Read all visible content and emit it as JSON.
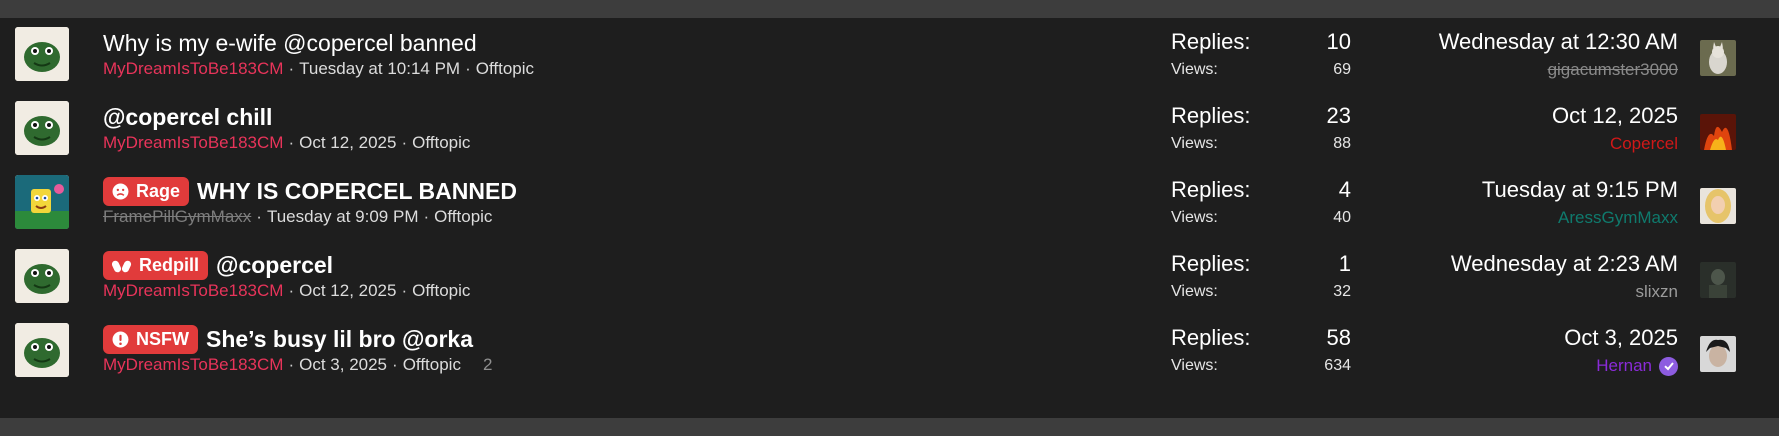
{
  "stat_labels": {
    "replies": "Replies:",
    "views": "Views:"
  },
  "colors": {
    "background": "#1e1e1e",
    "band": "#3d3d3d",
    "prefix_label": "#e13b3b",
    "author_pink": "#e8345a",
    "user_red": "#d01818",
    "user_teal": "#0f7a6d",
    "user_purple": "#8a2bd8"
  },
  "threads": [
    {
      "avatar_icon": "green-blob-avatar-icon",
      "prefix": null,
      "title": "Why is my e-wife @copercel banned",
      "title_bold": false,
      "author": "MyDreamIsToBe183CM",
      "date": "Tuesday at 10:14 PM",
      "forum": "Offtopic",
      "pages": null,
      "replies": "10",
      "views": "69",
      "last_date": "Wednesday at 12:30 AM",
      "last_user": "gigacumster3000",
      "last_user_style": "banned",
      "last_avatar_icon": "white-cat-avatar-icon",
      "verified": false
    },
    {
      "avatar_icon": "green-blob-avatar-icon",
      "prefix": null,
      "title": "@copercel chill",
      "title_bold": true,
      "author": "MyDreamIsToBe183CM",
      "date": "Oct 12, 2025",
      "forum": "Offtopic",
      "pages": null,
      "replies": "23",
      "views": "88",
      "last_date": "Oct 12, 2025",
      "last_user": "Copercel",
      "last_user_style": "red",
      "last_avatar_icon": "fire-avatar-icon",
      "verified": false
    },
    {
      "avatar_icon": "cartoon-sponge-avatar-icon",
      "prefix": {
        "text": "Rage",
        "icon": "angry-face-icon"
      },
      "title": "WHY IS COPERCEL BANNED",
      "title_bold": true,
      "author": "FramePillGymMaxx",
      "author_banned": true,
      "date": "Tuesday at 9:09 PM",
      "forum": "Offtopic",
      "pages": null,
      "replies": "4",
      "views": "40",
      "last_date": "Tuesday at 9:15 PM",
      "last_user": "AressGymMaxx",
      "last_user_style": "teal",
      "last_avatar_icon": "blonde-person-avatar-icon",
      "verified": false
    },
    {
      "avatar_icon": "green-blob-avatar-icon",
      "prefix": {
        "text": "Redpill",
        "icon": "pills-icon"
      },
      "title": "@copercel",
      "title_bold": true,
      "author": "MyDreamIsToBe183CM",
      "date": "Oct 12, 2025",
      "forum": "Offtopic",
      "pages": null,
      "replies": "1",
      "views": "32",
      "last_date": "Wednesday at 2:23 AM",
      "last_user": "slixzn",
      "last_user_style": "gray",
      "last_avatar_icon": "dark-figure-avatar-icon",
      "verified": false
    },
    {
      "avatar_icon": "green-blob-avatar-icon",
      "prefix": {
        "text": "NSFW",
        "icon": "exclamation-icon"
      },
      "title": "She’s busy lil bro @orka",
      "title_bold": true,
      "author": "MyDreamIsToBe183CM",
      "date": "Oct 3, 2025",
      "forum": "Offtopic",
      "pages": "2",
      "replies": "58",
      "views": "634",
      "last_date": "Oct 3, 2025",
      "last_user": "Hernan",
      "last_user_style": "purple",
      "last_avatar_icon": "dark-hair-face-avatar-icon",
      "verified": true
    }
  ]
}
